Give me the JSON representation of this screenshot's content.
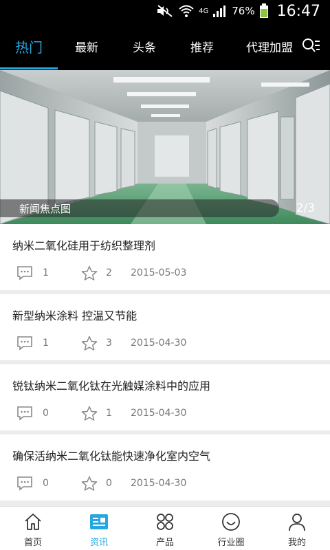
{
  "status_bar": {
    "network_type": "4G",
    "battery_percent": "76%",
    "time": "16:47",
    "icons": [
      "mute-icon",
      "wifi-icon",
      "signal-icon",
      "battery-icon"
    ]
  },
  "top_tabs": [
    {
      "label": "热门",
      "active": true
    },
    {
      "label": "最新",
      "active": false
    },
    {
      "label": "头条",
      "active": false
    },
    {
      "label": "推荐",
      "active": false
    },
    {
      "label": "代理加盟",
      "active": false
    }
  ],
  "banner": {
    "caption": "新闻焦点图",
    "counter": "2/3"
  },
  "articles": [
    {
      "title": "纳米二氧化硅用于纺织整理剂",
      "comments": "1",
      "favorites": "2",
      "date": "2015-05-03"
    },
    {
      "title": "新型纳米涂料 控温又节能",
      "comments": "1",
      "favorites": "3",
      "date": "2015-04-30"
    },
    {
      "title": "锐钛纳米二氧化钛在光触媒涂料中的应用",
      "comments": "0",
      "favorites": "1",
      "date": "2015-04-30"
    },
    {
      "title": "确保活纳米二氧化钛能快速净化室内空气",
      "comments": "0",
      "favorites": "0",
      "date": "2015-04-30"
    }
  ],
  "bottom_nav": [
    {
      "label": "首页",
      "icon": "home-icon",
      "active": false
    },
    {
      "label": "资讯",
      "icon": "news-icon",
      "active": true
    },
    {
      "label": "产品",
      "icon": "products-icon",
      "active": false
    },
    {
      "label": "行业圈",
      "icon": "smiley-icon",
      "active": false
    },
    {
      "label": "我的",
      "icon": "user-icon",
      "active": false
    }
  ],
  "colors": {
    "accent": "#27a7e0",
    "header_bg": "#000000",
    "floor_green": "#4f9a6c"
  }
}
